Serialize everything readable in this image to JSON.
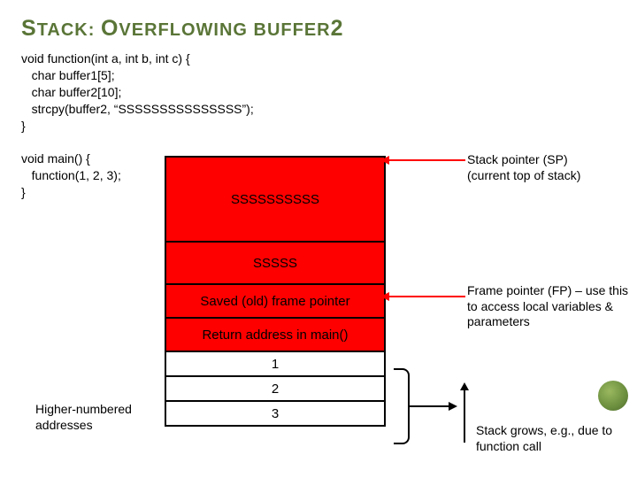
{
  "title_parts": {
    "s1": "S",
    "tack": "TACK",
    "colon": ": ",
    "o": "O",
    "ver": "VERFLOWING BUFFER",
    "two": "2"
  },
  "code": "void function(int a, int b, int c) {\n   char buffer1[5];\n   char buffer2[10];\n   strcpy(buffer2, “SSSSSSSSSSSSSSS”);\n}\n\nvoid main() {\n   function(1, 2, 3);\n}",
  "cells": {
    "buf2": "SSSSSSSSSS",
    "buf1": "SSSSS",
    "sfp": "Saved (old) frame pointer",
    "ret": "Return address in main()",
    "a1": "1",
    "a2": "2",
    "a3": "3"
  },
  "labels": {
    "sp": "Stack pointer (SP)\n(current top of stack)",
    "fp": "Frame pointer (FP) – use this to access local variables & parameters",
    "higher": "Higher-numbered addresses",
    "grows": "Stack grows, e.g., due to function call"
  }
}
